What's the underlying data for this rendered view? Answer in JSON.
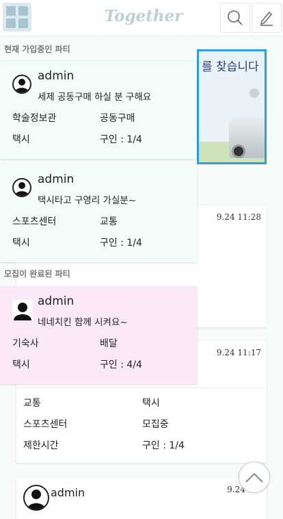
{
  "header": {
    "brand": "Together",
    "menu_icon": "grid-icon",
    "search_icon": "search-icon",
    "write_icon": "pencil-icon"
  },
  "banner": {
    "text": "를 찾습니다"
  },
  "feed": [
    {
      "time": "9.24 11:28"
    },
    {
      "time": "9.24 11:17",
      "rows": [
        {
          "label": "교통",
          "value": "택시"
        },
        {
          "label": "스포츠센터",
          "value": "모집중"
        },
        {
          "label": "제한시간",
          "value": "구인 : 1/4"
        }
      ]
    },
    {
      "time": "9.24 0:9",
      "author": "admin"
    }
  ],
  "panel": {
    "current_label": "현재 가입중인 파티",
    "done_label": "모집이 완료된 파티",
    "current": [
      {
        "author": "admin",
        "title": "세제 공동구매 하실 분 구해요",
        "place": "학술정보관",
        "category": "공동구매",
        "transport": "택시",
        "count": "구인 : 1/4"
      },
      {
        "author": "admin",
        "title": "택시타고 구영리 가실분~",
        "place": "스포츠센터",
        "category": "교통",
        "transport": "택시",
        "count": "구인 : 1/4"
      }
    ],
    "done": [
      {
        "author": "admin",
        "title": "네네치킨 함께 시켜요~",
        "place": "기숙사",
        "category": "배달",
        "transport": "택시",
        "count": "구인 : 4/4"
      }
    ]
  },
  "scroll_top_icon": "chevron-up-icon"
}
